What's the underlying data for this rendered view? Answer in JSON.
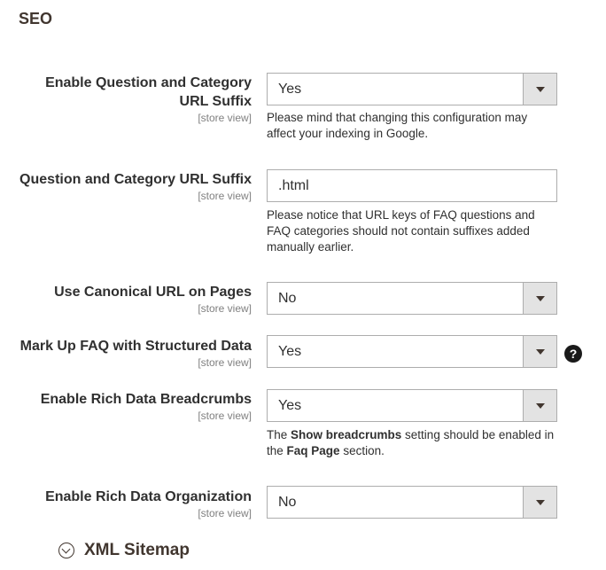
{
  "section": {
    "title": "SEO"
  },
  "fields": [
    {
      "label": "Enable Question and Category URL Suffix",
      "label_line1": "Enable Question and Category",
      "label_line2": "URL Suffix",
      "scope": "[store view]",
      "type": "select",
      "value": "Yes",
      "note": "Please mind that changing this configuration may affect your indexing in Google."
    },
    {
      "label": "Question and Category URL Suffix",
      "scope": "[store view]",
      "type": "text",
      "value": ".html",
      "note": "Please notice that URL keys of FAQ questions and FAQ categories should not contain suffixes added manually earlier."
    },
    {
      "label": "Use Canonical URL on Pages",
      "scope": "[store view]",
      "type": "select",
      "value": "No"
    },
    {
      "label": "Mark Up FAQ with Structured Data",
      "scope": "[store view]",
      "type": "select",
      "value": "Yes",
      "help": "?"
    },
    {
      "label": "Enable Rich Data Breadcrumbs",
      "scope": "[store view]",
      "type": "select",
      "value": "Yes",
      "note_parts": {
        "p1": "The ",
        "b1": "Show breadcrumbs",
        "p2": " setting should be enabled in the ",
        "b2": "Faq Page",
        "p3": " section."
      }
    },
    {
      "label": "Enable Rich Data Organization",
      "scope": "[store view]",
      "type": "select",
      "value": "No"
    }
  ],
  "collapsible": {
    "label": "XML Sitemap",
    "icon": "chevron-down-circle-icon"
  },
  "colors": {
    "border": "#adadad",
    "arrow_bg": "#e3e3e3",
    "scope_text": "#808080",
    "title": "#41362f"
  }
}
